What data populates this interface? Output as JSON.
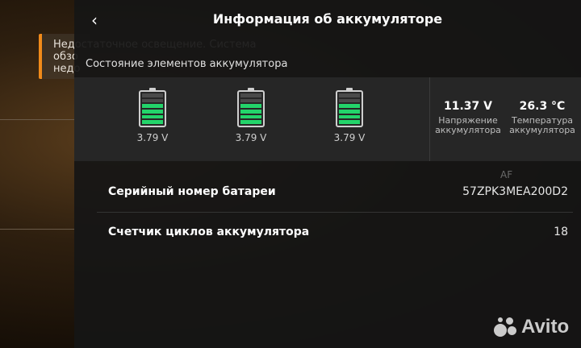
{
  "warning": {
    "text": "Недостаточное освещение. Система\nобзо\nнедо"
  },
  "header": {
    "back_icon": "chevron-left-icon",
    "title": "Информация об аккумуляторе"
  },
  "cells_section": {
    "label": "Состояние элементов аккумулятора",
    "cells": [
      {
        "voltage": "3.79 V",
        "level_segments": 6,
        "filled_segments": 4
      },
      {
        "voltage": "3.79 V",
        "level_segments": 6,
        "filled_segments": 4
      },
      {
        "voltage": "3.79 V",
        "level_segments": 6,
        "filled_segments": 4
      }
    ],
    "stats": [
      {
        "value": "11.37 V",
        "label": "Напряжение аккумулятора"
      },
      {
        "value": "26.3 °C",
        "label": "Температура аккумулятора"
      }
    ]
  },
  "rows": [
    {
      "label": "Серийный номер батареи",
      "value": "57ZPK3MEA200D2"
    },
    {
      "label": "Счетчик циклов аккумулятора",
      "value": "18"
    }
  ],
  "overlay": {
    "af_label": "AF",
    "watermark": "Avito"
  },
  "colors": {
    "accent_warning": "#f08a1a",
    "battery_fill": "#23d46a"
  }
}
